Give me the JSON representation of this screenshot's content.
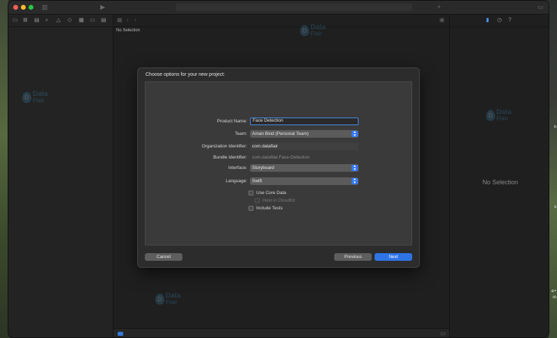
{
  "desktop": {
    "right_edge_texts": [
      "n",
      "s",
      "e+",
      "m"
    ]
  },
  "toolbar": {
    "icons": [
      "sidebar-toggle-icon",
      "run-icon",
      "add-icon",
      "library-icon"
    ]
  },
  "navigator": {
    "icons": [
      "folder-icon",
      "source-control-icon",
      "symbol-icon",
      "find-icon",
      "issue-icon",
      "test-icon",
      "debug-icon",
      "breakpoint-icon",
      "report-icon"
    ]
  },
  "editor": {
    "no_selection_label": "No Selection"
  },
  "inspector": {
    "empty_label": "No Selection"
  },
  "watermark": {
    "line1": "Data",
    "line2": "Flair"
  },
  "sheet": {
    "title": "Choose options for your new project:",
    "product_name": {
      "label": "Product Name:",
      "value": "Face Detection"
    },
    "team": {
      "label": "Team:",
      "value": "Aman Bind (Personal Team)"
    },
    "organization_identifier": {
      "label": "Organization Identifier:",
      "value": "com.dataflair"
    },
    "bundle_identifier": {
      "label": "Bundle Identifier:",
      "value": "com.dataflair.Face-Detection"
    },
    "interface": {
      "label": "Interface:",
      "value": "Storyboard"
    },
    "language": {
      "label": "Language:",
      "value": "Swift"
    },
    "use_core_data": {
      "label": "Use Core Data",
      "checked": false
    },
    "host_in_cloudkit": {
      "label": "Host in CloudKit",
      "checked": false,
      "enabled": false
    },
    "include_tests": {
      "label": "Include Tests",
      "checked": false
    },
    "buttons": {
      "cancel": "Cancel",
      "previous": "Previous",
      "next": "Next"
    }
  },
  "colors": {
    "accent": "#2f74e5",
    "focus_ring": "#4a8ff0"
  }
}
